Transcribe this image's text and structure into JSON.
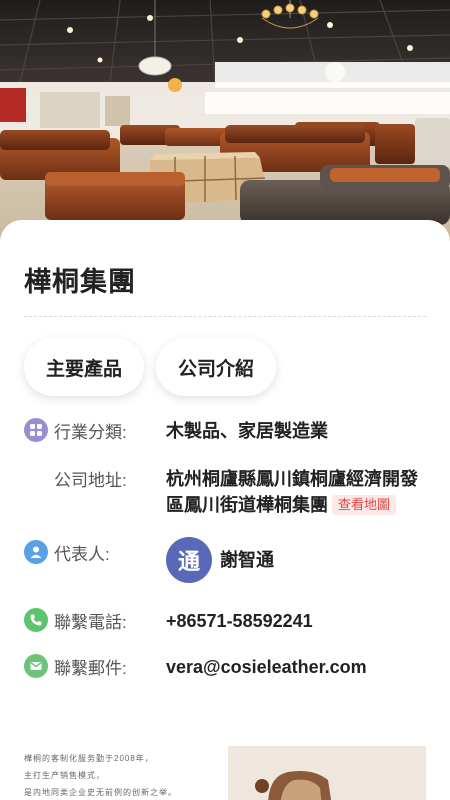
{
  "company": {
    "name": "樺桐集團"
  },
  "tabs": [
    {
      "label": "主要產品"
    },
    {
      "label": "公司介紹"
    }
  ],
  "info": {
    "industry": {
      "label": "行業分類:",
      "value": "木製品、家居製造業",
      "icon": "grid-icon",
      "icon_color": "#9b8cd6"
    },
    "address": {
      "label": "公司地址:",
      "value": "杭州桐廬縣鳳川鎮桐廬經濟開發區鳳川街道樺桐集團",
      "map_link": "查看地圖"
    },
    "representative": {
      "label": "代表人:",
      "name": "謝智通",
      "avatar_char": "通",
      "icon": "person-icon",
      "icon_color": "#5aa0e6"
    },
    "phone": {
      "label": "聯繫電話:",
      "value": "+86571-58592241",
      "icon": "phone-icon",
      "icon_color": "#5cc46e"
    },
    "email": {
      "label": "聯繫郵件:",
      "value": "vera@cosieleather.com",
      "icon": "mail-icon",
      "icon_color": "#6cc47a"
    }
  },
  "promo": {
    "lines": [
      "樺桐的客制化服务勤于2008年，",
      "主打生产销售模式，",
      "是内地同类企业史无前例的创新之举。"
    ]
  },
  "colors": {
    "accent_red": "#e04848",
    "avatar_bg": "#5a68b8"
  }
}
